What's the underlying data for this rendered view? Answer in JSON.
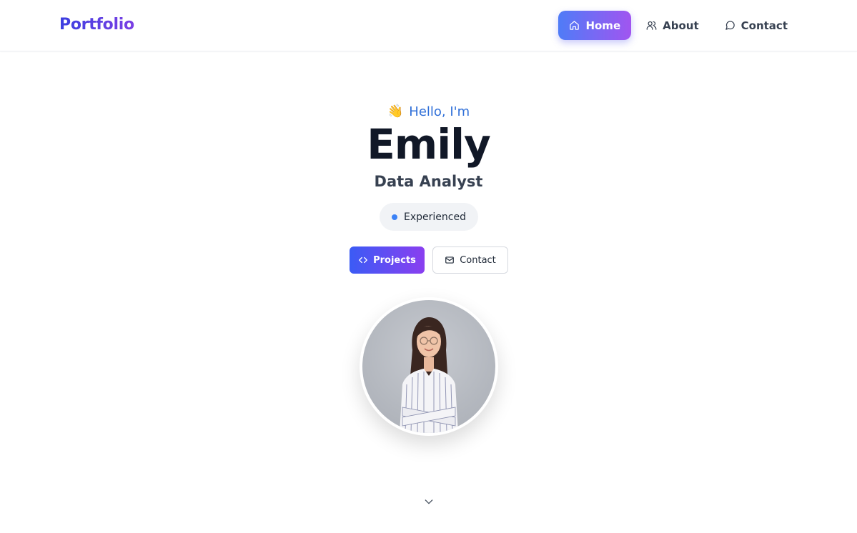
{
  "brand": "Portfolio",
  "nav": {
    "items": [
      {
        "label": "Home",
        "icon": "home-icon",
        "active": true
      },
      {
        "label": "About",
        "icon": "users-icon",
        "active": false
      },
      {
        "label": "Contact",
        "icon": "message-circle-icon",
        "active": false
      }
    ]
  },
  "hero": {
    "greeting_emoji": "👋",
    "greeting": "Hello, I'm",
    "name": "Emily",
    "role": "Data Analyst",
    "badge": "Experienced",
    "buttons": {
      "projects": "Projects",
      "contact": "Contact"
    }
  },
  "colors": {
    "accent_blue": "#3b82f6",
    "brand_gradient_start": "#3b3fe0",
    "brand_gradient_end": "#7b3fe4",
    "heading": "#111827"
  },
  "icons": {
    "projects": "code-icon",
    "contact": "mail-icon",
    "scroll": "chevron-down-icon"
  }
}
